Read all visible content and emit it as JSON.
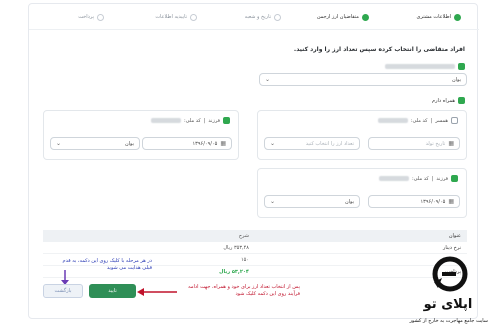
{
  "stepper": {
    "steps": [
      {
        "label": "اطلاعات مشتری",
        "state": "done"
      },
      {
        "label": "متقاضیان ارز ارجمن",
        "state": "active"
      },
      {
        "label": "تاریخ و شعبه",
        "state": "pending"
      },
      {
        "label": "تاییدیه اطلاعات",
        "state": "pending"
      },
      {
        "label": "پرداخت",
        "state": "pending"
      }
    ]
  },
  "question": "افراد متقاضی را انتخاب کرده سپس تعداد ارز را وارد کنید.",
  "applicant": {
    "checked": true,
    "currency_select": "یوان",
    "companion_label": "همراه دارم"
  },
  "companion_card_1": {
    "relation": "فرزند",
    "id_label": "کد ملی:",
    "birth_date": "۱۳۹۶/۰۹/۰۵",
    "currency_select": "یوان"
  },
  "companion_card_2": {
    "relation": "همسر",
    "id_label": "کد ملی:",
    "birth_placeholder": "تاریخ تولد",
    "currency_placeholder": "تعداد ارز را انتخاب کنید"
  },
  "companion_card_3": {
    "relation": "فرزند",
    "id_label": "کد ملی:",
    "birth_date": "۱۳۹۶/۰۹/۰۵",
    "currency_select": "یوان"
  },
  "table": {
    "headers": [
      "عنوان",
      "شرح"
    ],
    "rows": [
      [
        "نرخ دینار",
        "۳۵۳,۴۸ ریال"
      ],
      [
        "",
        "۱۵۰"
      ],
      [
        "پرداخت",
        "۵۳,۲۰۴ ریال"
      ]
    ]
  },
  "buttons": {
    "confirm": "تایید",
    "back": "بازگشت"
  },
  "notes": {
    "blue": "در هر مرحله با کلیک روی این دکمه، به قدم قبلی هدایت می شوید",
    "red": "پس از انتخاب تعداد ارز برای خود و همراه، جهت ادامه فرآیند روی این دکمه کلیک شود"
  },
  "logo": {
    "name": "اپلای تو",
    "site": "سایت جامع مهاجرت به خارج از کشور"
  },
  "colors": {
    "accent_green": "#2fa84f",
    "button_green": "#2f8f57",
    "note_blue": "#2a3bb5",
    "note_red": "#c0122b"
  }
}
